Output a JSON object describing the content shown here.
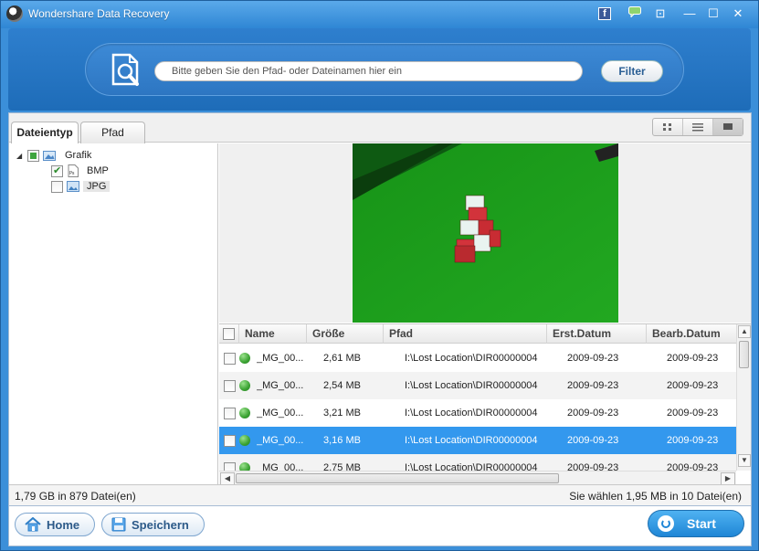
{
  "window": {
    "title": "Wondershare Data Recovery",
    "controls": {
      "minimize": "—",
      "maximize": "☐",
      "close": "✕",
      "facebook": "f",
      "register": "⊡"
    }
  },
  "search": {
    "placeholder": "Bitte geben Sie den Pfad- oder Dateinamen hier ein",
    "value": "",
    "filter_label": "Filter"
  },
  "tabs": [
    {
      "label": "Dateientyp",
      "active": true
    },
    {
      "label": "Pfad",
      "active": false
    }
  ],
  "view_modes": [
    "thumbnail-view",
    "list-view",
    "preview-view"
  ],
  "tree": {
    "root": {
      "label": "Grafik",
      "state": "partial",
      "expanded": true
    },
    "children": [
      {
        "label": "BMP",
        "checked": true
      },
      {
        "label": "JPG",
        "checked": false,
        "highlighted": true
      }
    ]
  },
  "table": {
    "columns": [
      "Name",
      "Größe",
      "Pfad",
      "Erst.Datum",
      "Bearb.Datum"
    ],
    "rows": [
      {
        "name": "_MG_00...",
        "size": "2,61 MB",
        "path": "I:\\Lost Location\\DIR00000004",
        "created": "2009-09-23",
        "modified": "2009-09-23",
        "selected": false
      },
      {
        "name": "_MG_00...",
        "size": "2,54 MB",
        "path": "I:\\Lost Location\\DIR00000004",
        "created": "2009-09-23",
        "modified": "2009-09-23",
        "selected": false
      },
      {
        "name": "_MG_00...",
        "size": "3,21 MB",
        "path": "I:\\Lost Location\\DIR00000004",
        "created": "2009-09-23",
        "modified": "2009-09-23",
        "selected": false
      },
      {
        "name": "_MG_00...",
        "size": "3,16 MB",
        "path": "I:\\Lost Location\\DIR00000004",
        "created": "2009-09-23",
        "modified": "2009-09-23",
        "selected": true
      },
      {
        "name": "_MG_00...",
        "size": "2,75 MB",
        "path": "I:\\Lost Location\\DIR00000004",
        "created": "2009-09-23",
        "modified": "2009-09-23",
        "selected": false
      }
    ]
  },
  "status": {
    "left": "1,79 GB in 879 Datei(en)",
    "right": "Sie wählen 1,95 MB in 10 Datei(en)"
  },
  "bottom": {
    "home": "Home",
    "save": "Speichern",
    "start": "Start"
  },
  "colors": {
    "accent": "#2f86d4",
    "selected_row": "#3398ee",
    "status_dot": "#3aa232",
    "felt": "#1f9a1c"
  }
}
